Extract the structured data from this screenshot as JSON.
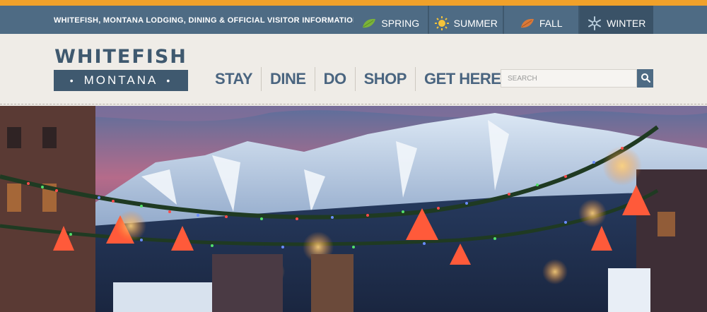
{
  "site": {
    "tagline": "WHITEFISH, MONTANA LODGING, DINING & OFFICIAL VISITOR INFORMATION"
  },
  "seasons": [
    {
      "label": "SPRING",
      "icon": "leaf-icon",
      "active": false
    },
    {
      "label": "SUMMER",
      "icon": "sun-icon",
      "active": false
    },
    {
      "label": "FALL",
      "icon": "fall-leaf-icon",
      "active": false
    },
    {
      "label": "WINTER",
      "icon": "snowflake-icon",
      "active": true
    }
  ],
  "logo": {
    "top": "WHITEFISH",
    "bottom": "MONTANA"
  },
  "nav": {
    "items": [
      "STAY",
      "DINE",
      "DO",
      "SHOP",
      "GET HERE"
    ]
  },
  "search": {
    "placeholder": "SEARCH"
  },
  "hero": {
    "description_icon": "mountain-town-photo"
  },
  "colors": {
    "accent": "#f0a12a",
    "brand": "#4e6b84",
    "brand_dark": "#3f596f",
    "background": "#ece9e4"
  }
}
